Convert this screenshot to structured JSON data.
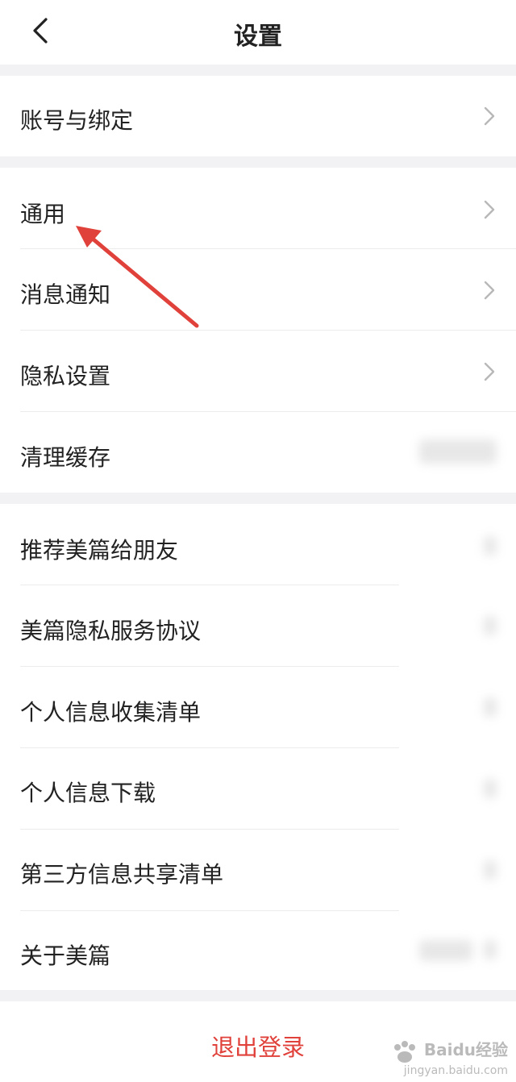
{
  "header": {
    "title": "设置"
  },
  "sections": [
    {
      "items": [
        {
          "label": "账号与绑定",
          "chevron": true
        }
      ]
    },
    {
      "items": [
        {
          "label": "通用",
          "chevron": true
        },
        {
          "label": "消息通知",
          "chevron": true
        },
        {
          "label": "隐私设置",
          "chevron": true
        },
        {
          "label": "清理缓存",
          "chevron": false
        }
      ]
    },
    {
      "items": [
        {
          "label": "推荐美篇给朋友"
        },
        {
          "label": "美篇隐私服务协议"
        },
        {
          "label": "个人信息收集清单"
        },
        {
          "label": "个人信息下载"
        },
        {
          "label": "第三方信息共享清单"
        },
        {
          "label": "关于美篇"
        }
      ]
    }
  ],
  "logout": {
    "label": "退出登录"
  },
  "watermark": {
    "brand": "Baidu经验",
    "url": "jingyan.baidu.com"
  },
  "colors": {
    "accent": "#e0413a",
    "annotation_arrow": "#e0413a",
    "section_gap": "#f2f2f4"
  },
  "icons": {
    "back": "chevron-left-icon",
    "chevron": "chevron-right-icon"
  }
}
